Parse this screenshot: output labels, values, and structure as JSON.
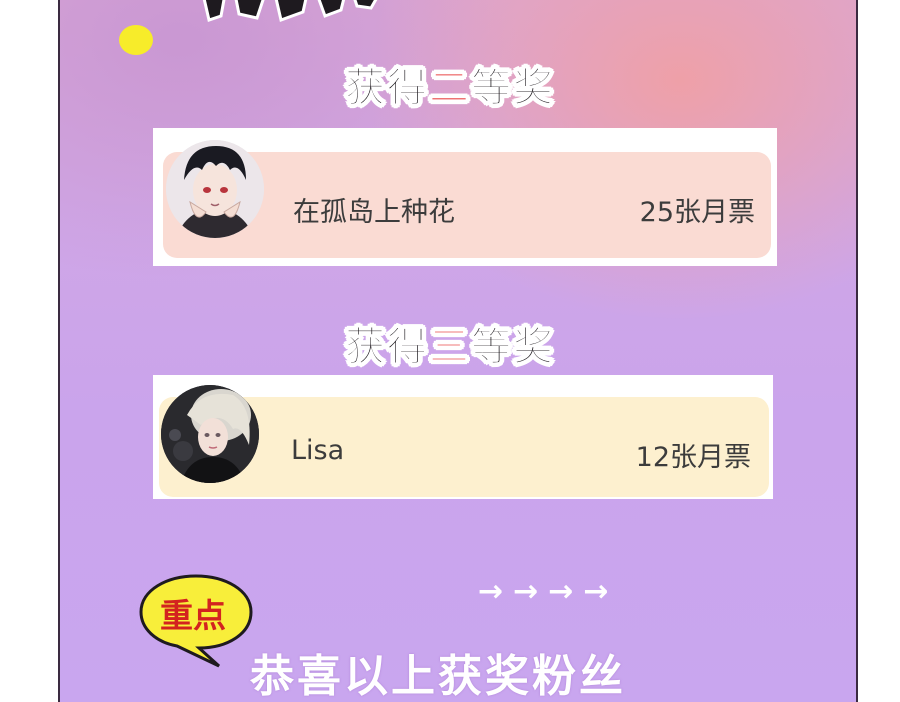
{
  "section_second": {
    "prefix": "获得",
    "accent": "二",
    "suffix": "等奖"
  },
  "winner_second": {
    "name": "在孤岛上种花",
    "votes": "25张月票"
  },
  "section_third": {
    "prefix": "获得",
    "accent": "三",
    "suffix": "等奖"
  },
  "winner_third": {
    "name": "Lisa",
    "votes": "12张月票"
  },
  "bubble_label": "重点",
  "arrows": "→→→→",
  "congrats": "恭喜以上获奖粉丝",
  "colors": {
    "accent_red": "#e83d3d",
    "card_pink": "#fadbd3",
    "card_cream": "#fdf0cf",
    "bubble_yellow": "#f8ee3a",
    "dot_yellow": "#f7ec2a"
  },
  "icons": [
    "avatar-anime-boy",
    "avatar-anime-girl",
    "speech-bubble"
  ]
}
